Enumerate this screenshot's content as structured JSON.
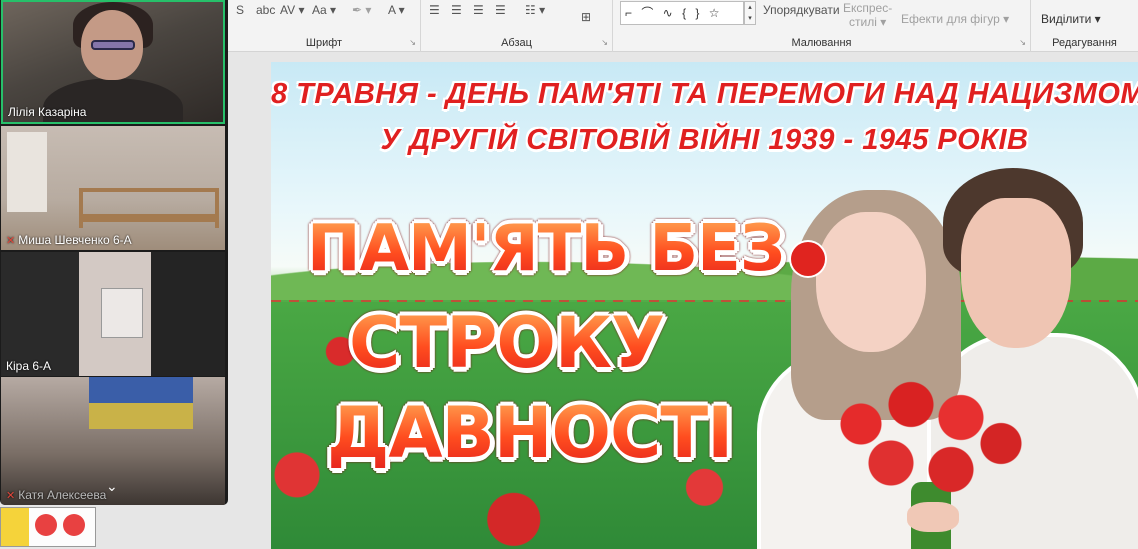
{
  "ribbon": {
    "font": {
      "label": "Шрифт",
      "tools": [
        {
          "name": "strike-icon",
          "glyph": "S"
        },
        {
          "name": "abc-strike-icon",
          "glyph": "abc"
        },
        {
          "name": "char-spacing-icon",
          "glyph": "AV ▾"
        },
        {
          "name": "change-case-icon",
          "glyph": "Aa ▾"
        },
        {
          "name": "highlight-icon",
          "glyph": "✒ ▾"
        },
        {
          "name": "font-color-icon",
          "glyph": "A ▾"
        }
      ]
    },
    "paragraph": {
      "label": "Абзац",
      "tools": [
        {
          "name": "align-left-icon",
          "glyph": "☰"
        },
        {
          "name": "align-center-icon",
          "glyph": "☰"
        },
        {
          "name": "align-right-icon",
          "glyph": "☰"
        },
        {
          "name": "justify-icon",
          "glyph": "☰"
        },
        {
          "name": "columns-icon",
          "glyph": "☷ ▾"
        },
        {
          "name": "smartart-icon",
          "glyph": "⊞"
        }
      ]
    },
    "drawing": {
      "label": "Малювання",
      "shapes": "⌐ ⌒ ∿ { } ☆",
      "arrange": "Упорядкувати",
      "quick_styles_line1": "Експрес-",
      "quick_styles_line2": "стилі ▾",
      "shape_effects": "Ефекти для фігур ▾"
    },
    "editing": {
      "label": "Редагування",
      "select": "Виділити ▾"
    }
  },
  "participants": [
    {
      "name": "Лілія Казаріна",
      "muted": false,
      "active": true
    },
    {
      "name": "Миша Шевченко 6-А",
      "muted": true,
      "active": false
    },
    {
      "name": "Кіра 6-А",
      "muted": false,
      "active": false
    },
    {
      "name": "Катя Алексеева",
      "muted": true,
      "active": false
    }
  ],
  "gallery_toggle": "⌄",
  "slide": {
    "heading_line1": "8 ТРАВНЯ - ДЕНЬ ПАМ'ЯТІ ТА ПЕРЕМОГИ НАД НАЦИЗМОМ",
    "heading_line2": "У ДРУГІЙ  СВІТОВІЙ ВІЙНІ  1939 - 1945 РОКІВ",
    "big_line1": "ПАМ'ЯТЬ БЕЗ",
    "big_line2": "СТРОКУ",
    "big_line3": "ДАВНОСТІ"
  },
  "colors": {
    "active_speaker": "#27c06a",
    "heading_red": "#e02020",
    "big_orange": "#ff5a20"
  }
}
